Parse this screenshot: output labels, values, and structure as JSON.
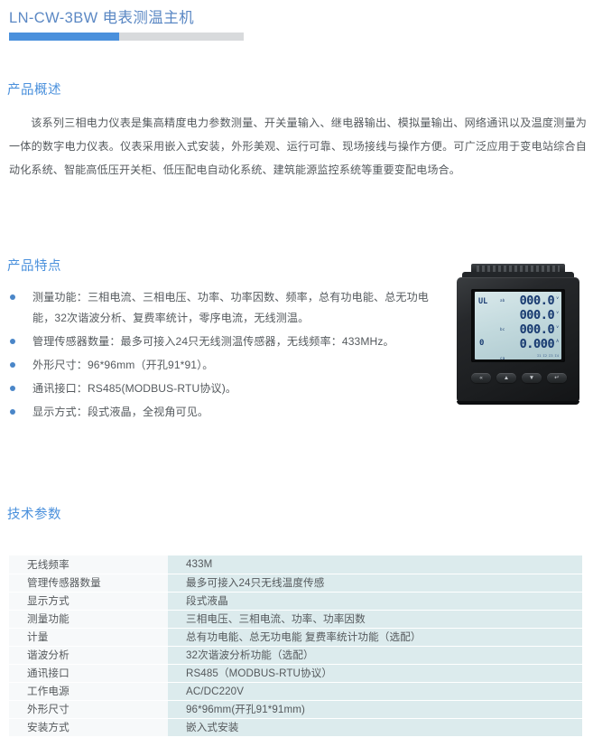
{
  "header": {
    "title": "LN-CW-3BW 电表测温主机",
    "rule_fill_color": "#4a90dc",
    "rule_track_color": "#d8dadc"
  },
  "sections": {
    "overview": {
      "heading": "产品概述",
      "body": "该系列三相电力仪表是集高精度电力参数测量、开关量输入、继电器输出、模拟量输出、网络通讯以及温度测量为一体的数字电力仪表。仪表采用嵌入式安装，外形美观、运行可靠、现场接线与操作方便。可广泛应用于变电站综合自动化系统、智能高低压开关柜、低压配电自动化系统、建筑能源监控系统等重要变配电场合。"
    },
    "features": {
      "heading": "产品特点",
      "items": [
        "测量功能：三相电流、三相电压、功率、功率因数、频率，总有功电能、总无功电能，32次谐波分析、复费率统计，零序电流，无线测温。",
        "管理传感器数量：最多可接入24只无线测温传感器，无线频率：433MHz。",
        "外形尺寸：96*96mm（开孔91*91）。",
        "通讯接口：RS485(MODBUS-RTU协议)。",
        "显示方式：段式液晶，全视角可见。"
      ]
    },
    "specs": {
      "heading": "技术参数",
      "rows": [
        {
          "label": "无线频率",
          "value": "433M"
        },
        {
          "label": "管理传感器数量",
          "value": "最多可接入24只无线温度传感"
        },
        {
          "label": "显示方式",
          "value": "段式液晶"
        },
        {
          "label": "测量功能",
          "value": "三相电压、三相电流、功率、功率因数"
        },
        {
          "label": "计量",
          "value": "总有功电能、总无功电能 复费率统计功能（选配）"
        },
        {
          "label": "谐波分析",
          "value": "32次谐波分析功能（选配）"
        },
        {
          "label": "通讯接口",
          "value": "RS485（MODBUS-RTU协议）"
        },
        {
          "label": "工作电源",
          "value": "AC/DC220V"
        },
        {
          "label": "外形尺寸",
          "value": "96*96mm(开孔91*91mm)"
        },
        {
          "label": "安装方式",
          "value": "嵌入式安装"
        }
      ]
    }
  },
  "product_photo": {
    "lcd": {
      "ul_label": "UL",
      "zero_label": "0",
      "rows": [
        {
          "tag": "ab",
          "digits": "000.0",
          "unit": "v"
        },
        {
          "tag": "bc",
          "digits": "000.0",
          "unit": "v"
        },
        {
          "tag": "ca",
          "digits": "000.0",
          "unit": "v"
        },
        {
          "tag": "",
          "digits": "0.000",
          "unit": "A"
        }
      ],
      "footer_marks": "Σ1  Σ2  Σ3  Σ4"
    },
    "buttons": [
      {
        "glyph": "«",
        "name": "back-button"
      },
      {
        "glyph": "▲",
        "name": "up-button"
      },
      {
        "glyph": "▼",
        "name": "down-button"
      },
      {
        "glyph": "↵",
        "name": "enter-button"
      }
    ]
  }
}
